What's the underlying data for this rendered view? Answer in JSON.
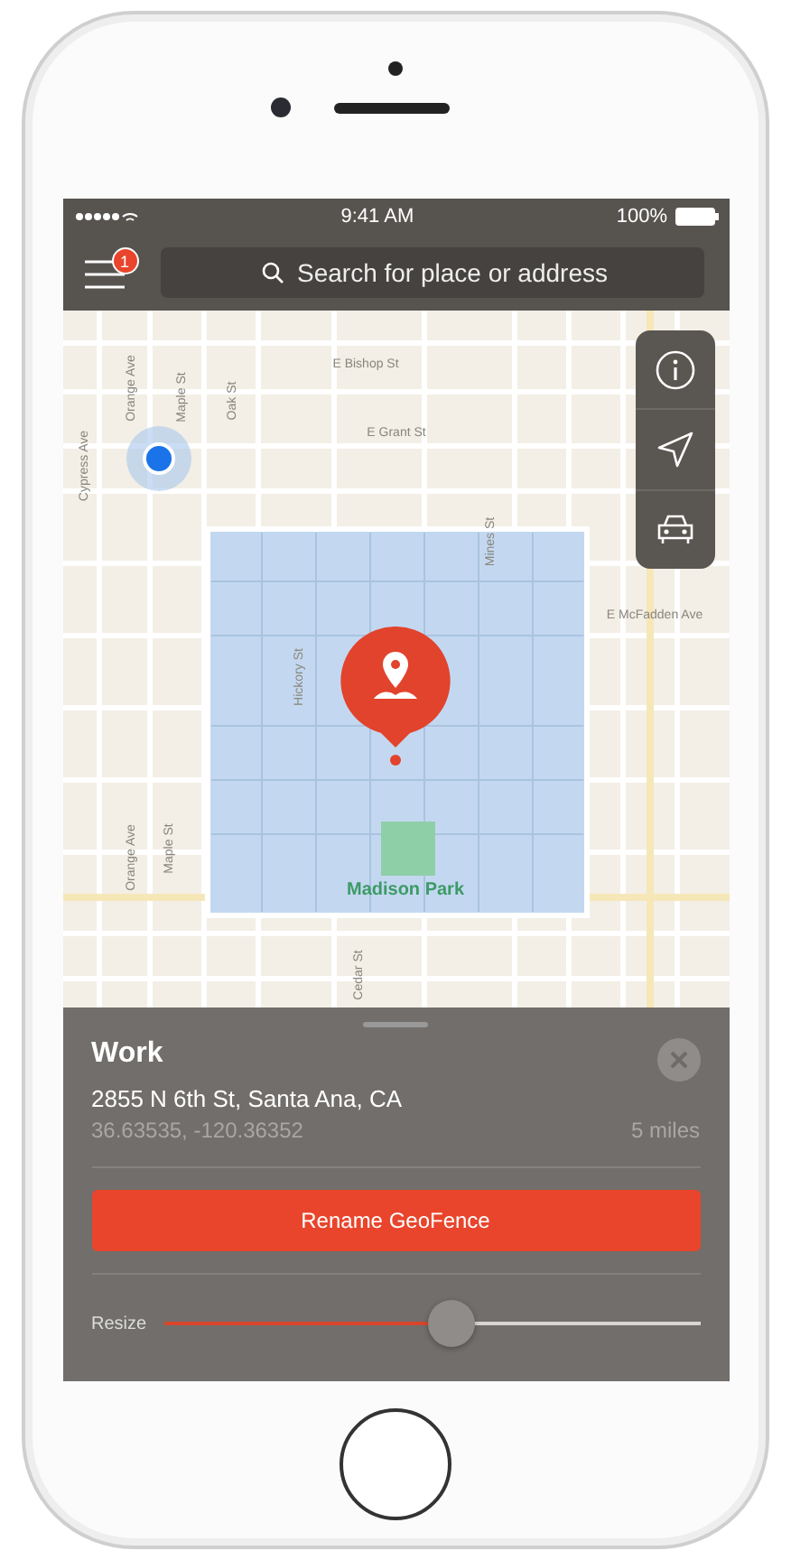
{
  "status_bar": {
    "time": "9:41 AM",
    "battery": "100%"
  },
  "nav_bar": {
    "badge": "1",
    "search": {
      "placeholder": "Search for place or address"
    }
  },
  "map": {
    "labels": [
      {
        "text": "E Bishop St",
        "kind": "horizontal"
      },
      {
        "text": "E Grant St",
        "kind": "horizontal"
      },
      {
        "text": "Orange Ave",
        "kind": "vertical"
      },
      {
        "text": "Maple St",
        "kind": "vertical"
      },
      {
        "text": "Oak St",
        "kind": "vertical"
      },
      {
        "text": "Cypress Ave",
        "kind": "vertical"
      },
      {
        "text": "Mines St",
        "kind": "vertical"
      },
      {
        "text": "Hickory St",
        "kind": "vertical"
      },
      {
        "text": "E McFadden Ave",
        "kind": "horizontal"
      },
      {
        "text": "Orange Ave",
        "kind": "vertical"
      },
      {
        "text": "Maple St",
        "kind": "vertical"
      },
      {
        "text": "Madison Park",
        "kind": "park"
      },
      {
        "text": "Cedar St",
        "kind": "vertical"
      }
    ]
  },
  "geofence": {
    "title": "Work",
    "address": "2855 N 6th St, Santa Ana, CA",
    "coordinates": "36.63535, -120.36352",
    "distance": "5 miles",
    "button": "Rename GeoFence",
    "slider": {
      "label": "Resize",
      "level": 0.54
    }
  }
}
